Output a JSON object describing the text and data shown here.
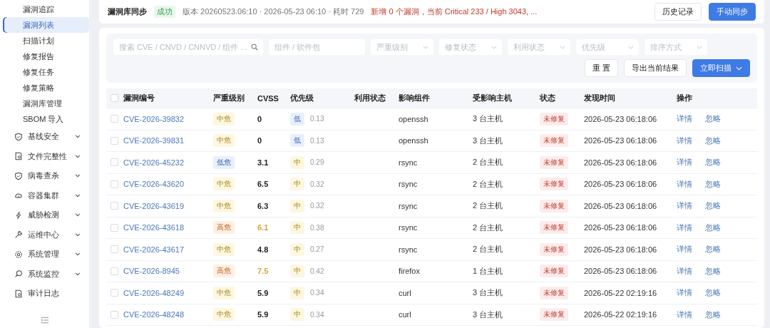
{
  "sidebar": {
    "sub_items": [
      {
        "label": "漏洞追踪",
        "selected": false
      },
      {
        "label": "漏洞列表",
        "selected": true
      },
      {
        "label": "扫描计划",
        "selected": false
      },
      {
        "label": "修复报告",
        "selected": false
      },
      {
        "label": "修复任务",
        "selected": false
      },
      {
        "label": "修复策略",
        "selected": false
      },
      {
        "label": "漏洞库管理",
        "selected": false
      },
      {
        "label": "SBOM 导入",
        "selected": false
      }
    ],
    "groups": [
      {
        "label": "基线安全",
        "expandable": true
      },
      {
        "label": "文件完整性",
        "expandable": true
      },
      {
        "label": "病毒查杀",
        "expandable": true
      },
      {
        "label": "容器集群",
        "expandable": true
      },
      {
        "label": "威胁检测",
        "expandable": true
      },
      {
        "label": "运维中心",
        "expandable": true
      },
      {
        "label": "系统管理",
        "expandable": true
      },
      {
        "label": "系统监控",
        "expandable": true
      },
      {
        "label": "审计日志",
        "expandable": false
      }
    ]
  },
  "sync_bar": {
    "title": "漏洞库同步",
    "status": "成功",
    "meta": "版本 20260523.06:10 · 2026-05-23 06:10 · 耗时 729",
    "summary": "新增 0 个漏洞，当前 Critical 233 / High 3043, ...",
    "buttons": [
      {
        "label": "历史记录",
        "kind": "default"
      },
      {
        "label": "手动同步",
        "kind": "primary"
      }
    ]
  },
  "filters": {
    "search": {
      "placeholder": "搜索 CVE / CNVD / CNNVD / 组件 ..."
    },
    "component": {
      "placeholder": "组件 / 软件包"
    },
    "dropdowns": [
      {
        "placeholder": "严重级别"
      },
      {
        "placeholder": "修复状态"
      },
      {
        "placeholder": "利用状态"
      },
      {
        "placeholder": "优先级"
      },
      {
        "placeholder": "排序方式"
      }
    ],
    "buttons": [
      {
        "label": "重 置",
        "kind": "default"
      },
      {
        "label": "导出当前结果",
        "kind": "default"
      },
      {
        "label": "立即扫描",
        "kind": "primary"
      }
    ]
  },
  "table": {
    "select_all": {
      "checked": false
    },
    "columns": [
      "漏洞编号",
      "严重级别",
      "CVSS",
      "优先级",
      "利用状态",
      "影响组件",
      "受影响主机",
      "状态",
      "发现时间",
      "操作"
    ],
    "rows": [
      {
        "checked": false,
        "id": "CVE-2026-39832",
        "severity": {
          "label": "中危",
          "kind": "medium"
        },
        "cvss": "0",
        "priority": {
          "label": "低",
          "kind": "low",
          "score": "0.13"
        },
        "component": "openssh",
        "hosts": "3 台主机",
        "status": "未修复",
        "time": "2026-05-23 06:18:06",
        "actions": [
          "详情",
          "忽略"
        ]
      },
      {
        "checked": false,
        "id": "CVE-2026-39831",
        "severity": {
          "label": "中危",
          "kind": "medium"
        },
        "cvss": "0",
        "priority": {
          "label": "低",
          "kind": "low",
          "score": "0.13"
        },
        "component": "openssh",
        "hosts": "3 台主机",
        "status": "未修复",
        "time": "2026-05-23 06:18:06",
        "actions": [
          "详情",
          "忽略"
        ]
      },
      {
        "checked": false,
        "id": "CVE-2026-45232",
        "severity": {
          "label": "低危",
          "kind": "low"
        },
        "cvss": "3.1",
        "priority": {
          "label": "中",
          "kind": "medium",
          "score": "0.29"
        },
        "component": "rsync",
        "hosts": "2 台主机",
        "status": "未修复",
        "time": "2026-05-23 06:18:06",
        "actions": [
          "详情",
          "忽略"
        ]
      },
      {
        "checked": false,
        "id": "CVE-2026-43620",
        "severity": {
          "label": "中危",
          "kind": "medium"
        },
        "cvss": "6.5",
        "priority": {
          "label": "中",
          "kind": "medium",
          "score": "0.32"
        },
        "component": "rsync",
        "hosts": "2 台主机",
        "status": "未修复",
        "time": "2026-05-23 06:18:06",
        "actions": [
          "详情",
          "忽略"
        ]
      },
      {
        "checked": false,
        "id": "CVE-2026-43619",
        "severity": {
          "label": "中危",
          "kind": "medium"
        },
        "cvss": "6.3",
        "priority": {
          "label": "中",
          "kind": "medium",
          "score": "0.32"
        },
        "component": "rsync",
        "hosts": "2 台主机",
        "status": "未修复",
        "time": "2026-05-23 06:18:06",
        "actions": [
          "详情",
          "忽略"
        ]
      },
      {
        "checked": false,
        "id": "CVE-2026-43618",
        "severity": {
          "label": "高危",
          "kind": "high"
        },
        "cvss": "6.1",
        "priority": {
          "label": "中",
          "kind": "medium",
          "score": "0.38"
        },
        "component": "rsync",
        "hosts": "2 台主机",
        "status": "未修复",
        "time": "2026-05-23 06:18:06",
        "actions": [
          "详情",
          "忽略"
        ]
      },
      {
        "checked": false,
        "id": "CVE-2026-43617",
        "severity": {
          "label": "中危",
          "kind": "medium"
        },
        "cvss": "4.8",
        "priority": {
          "label": "中",
          "kind": "medium",
          "score": "0.27"
        },
        "component": "rsync",
        "hosts": "2 台主机",
        "status": "未修复",
        "time": "2026-05-23 06:18:06",
        "actions": [
          "详情",
          "忽略"
        ]
      },
      {
        "checked": false,
        "id": "CVE-2026-8945",
        "severity": {
          "label": "高危",
          "kind": "high"
        },
        "cvss": "7.5",
        "priority": {
          "label": "中",
          "kind": "medium",
          "score": "0.42"
        },
        "component": "firefox",
        "hosts": "1 台主机",
        "status": "未修复",
        "time": "2026-05-23 06:18:06",
        "actions": [
          "详情",
          "忽略"
        ]
      },
      {
        "checked": false,
        "id": "CVE-2026-48249",
        "severity": {
          "label": "中危",
          "kind": "medium"
        },
        "cvss": "5.9",
        "priority": {
          "label": "中",
          "kind": "medium",
          "score": "0.34"
        },
        "component": "curl",
        "hosts": "3 台主机",
        "status": "未修复",
        "time": "2026-05-22 02:19:16",
        "actions": [
          "详情",
          "忽略"
        ]
      },
      {
        "checked": false,
        "id": "CVE-2026-48248",
        "severity": {
          "label": "中危",
          "kind": "medium"
        },
        "cvss": "5.9",
        "priority": {
          "label": "中",
          "kind": "medium",
          "score": "0.34"
        },
        "component": "curl",
        "hosts": "3 台主机",
        "status": "未修复",
        "time": "2026-05-22 02:19:16",
        "actions": [
          "详情",
          "忽略"
        ]
      }
    ]
  }
}
